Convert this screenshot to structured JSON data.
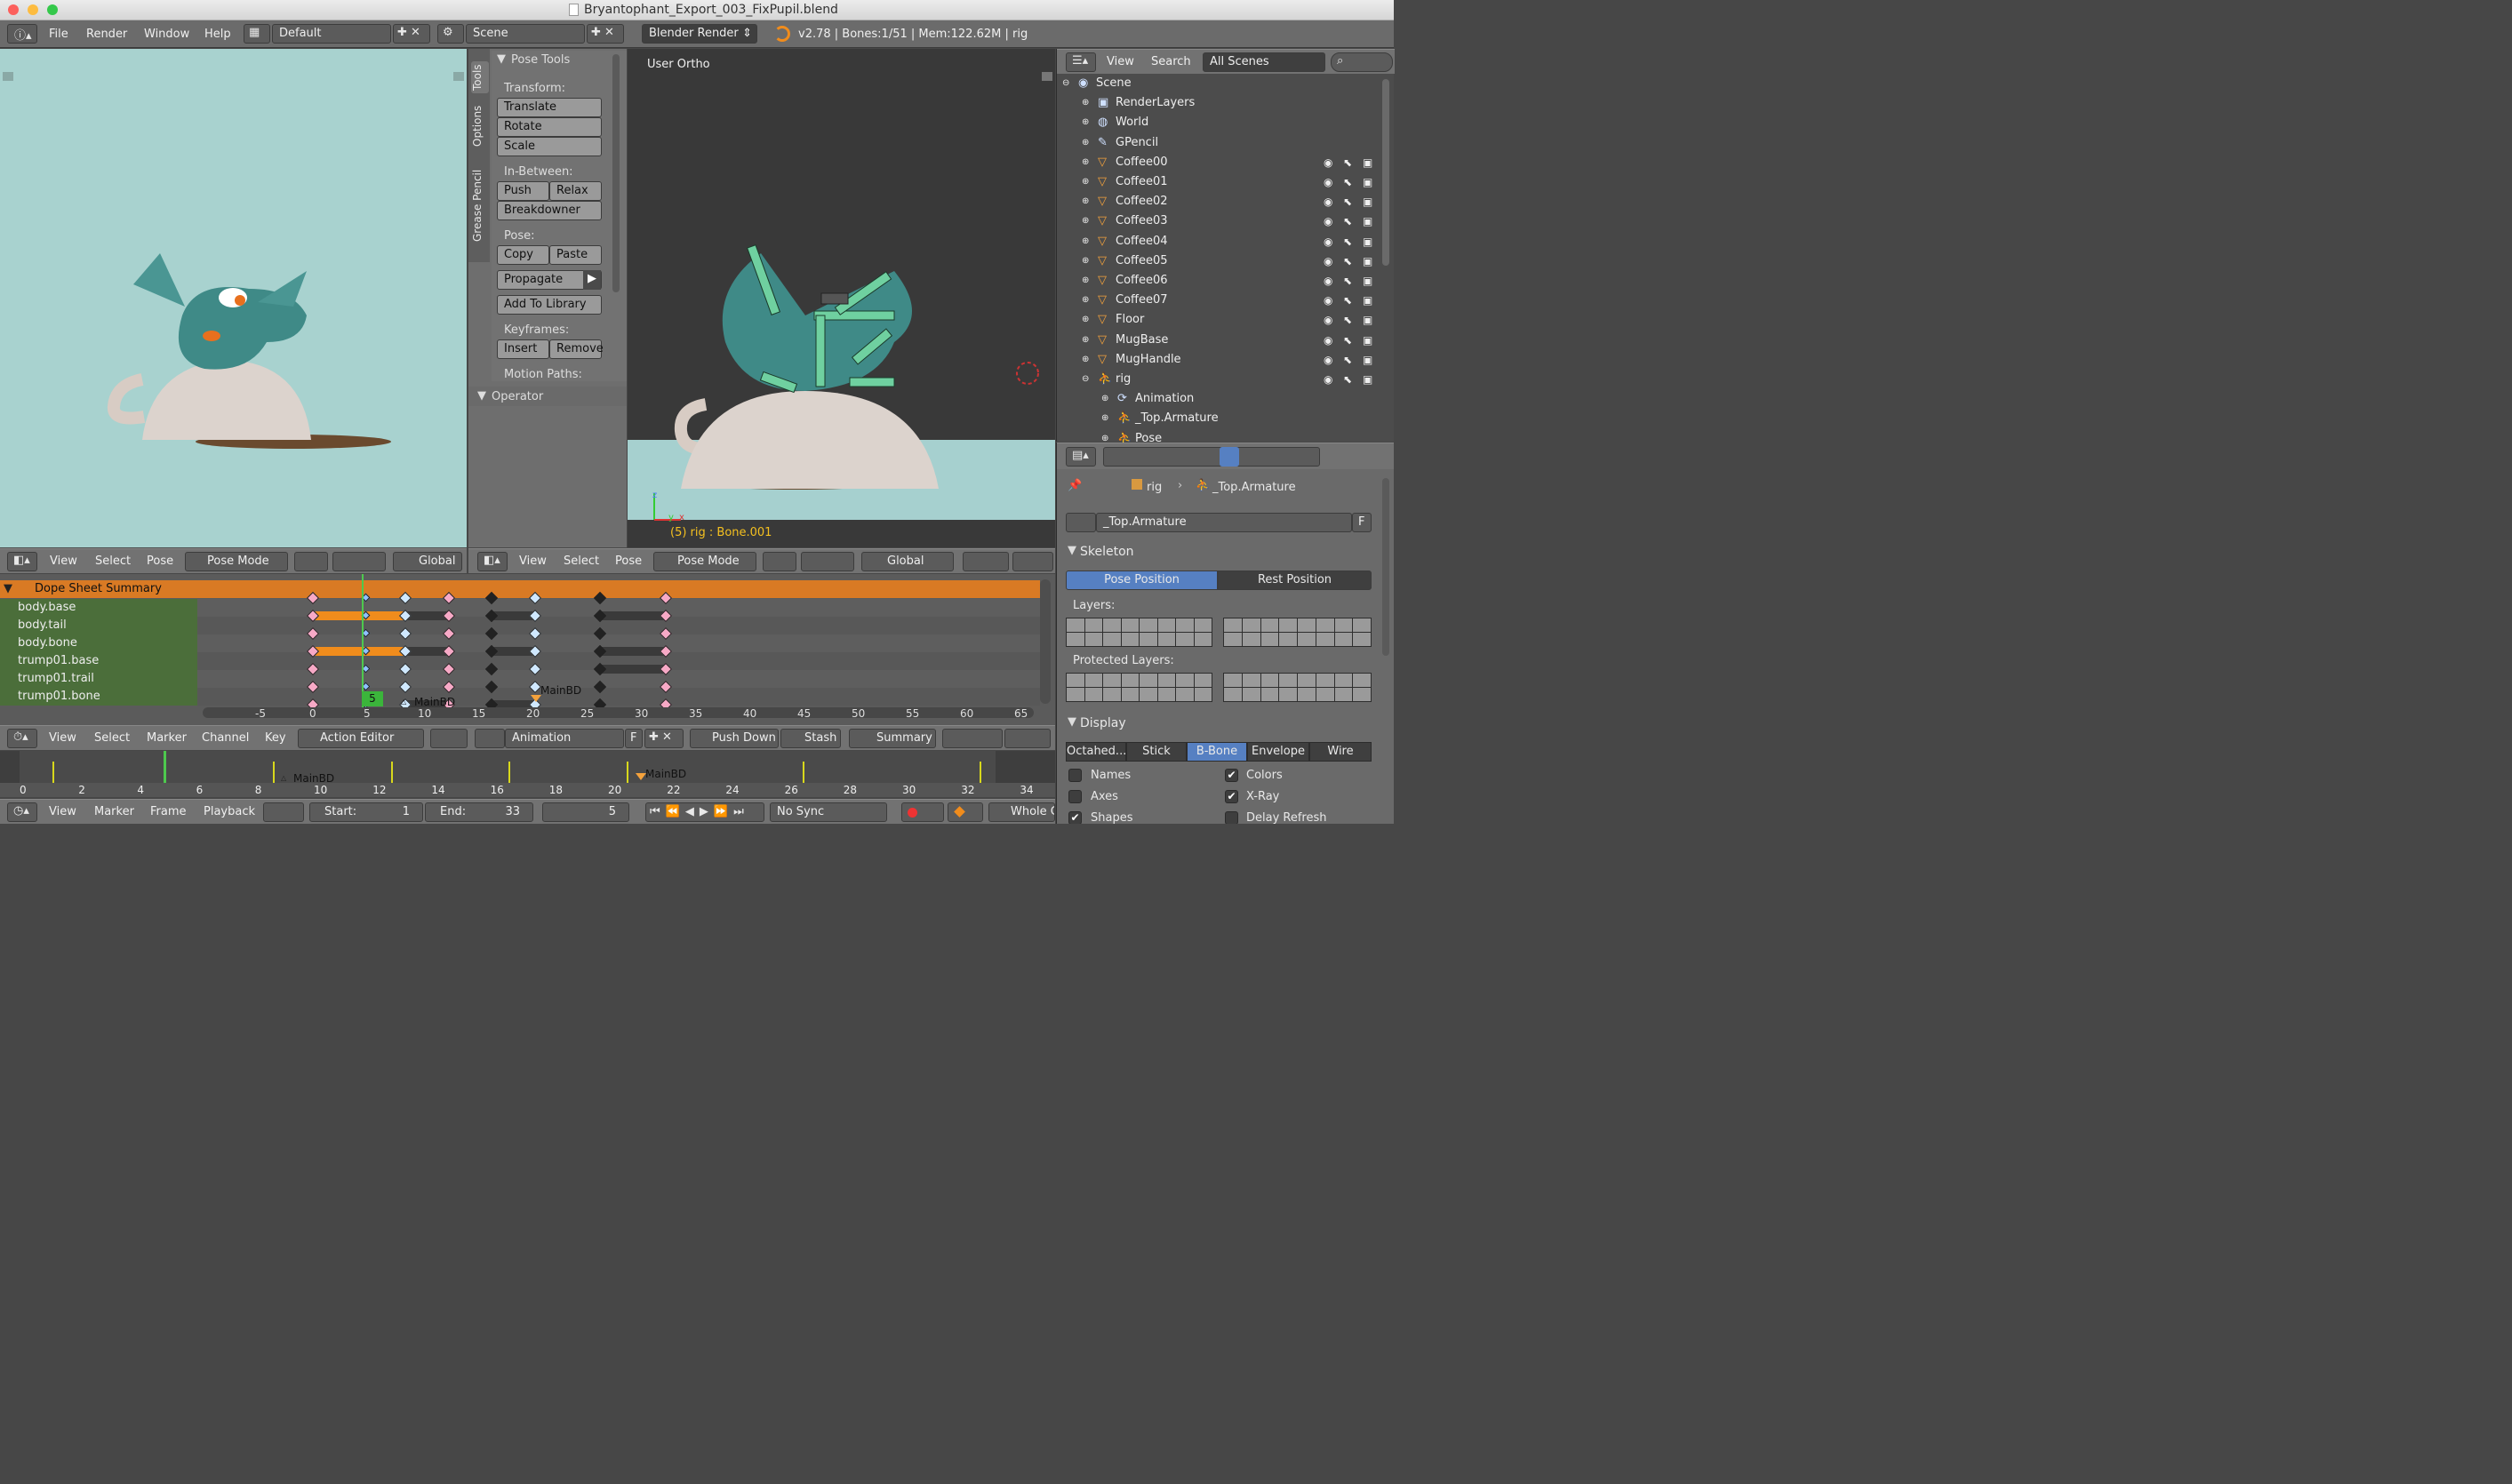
{
  "window": {
    "title": "Bryantophant_Export_003_FixPupil.blend"
  },
  "menubar": {
    "menus": [
      "File",
      "Render",
      "Window",
      "Help"
    ],
    "layout": "Default",
    "scene": "Scene",
    "engine": "Blender Render",
    "stats": "v2.78 | Bones:1/51 | Mem:122.62M | rig"
  },
  "tool_shelf": {
    "tabs": [
      "Tools",
      "Options",
      "Grease Pencil"
    ],
    "panel_title": "Pose Tools",
    "transform_label": "Transform:",
    "translate": "Translate",
    "rotate": "Rotate",
    "scale": "Scale",
    "inbetween_label": "In-Between:",
    "push": "Push",
    "relax": "Relax",
    "breakdowner": "Breakdowner",
    "pose_label": "Pose:",
    "copy": "Copy",
    "paste": "Paste",
    "propagate": "Propagate",
    "add_to_library": "Add To Library",
    "keyframes_label": "Keyframes:",
    "insert": "Insert",
    "remove": "Remove",
    "motion_paths_label": "Motion Paths:",
    "operator": "Operator"
  },
  "viewport_right": {
    "label": "User Ortho",
    "status": "(5) rig : Bone.001",
    "axis_z": "z",
    "axis_y": "y",
    "axis_x": "x"
  },
  "view3d_header": {
    "view": "View",
    "select": "Select",
    "pose": "Pose",
    "mode": "Pose Mode",
    "orientation": "Global"
  },
  "outliner": {
    "view": "View",
    "search": "Search",
    "filter": "All Scenes",
    "items": [
      {
        "label": "Scene"
      },
      {
        "label": "RenderLayers"
      },
      {
        "label": "World"
      },
      {
        "label": "GPencil"
      },
      {
        "label": "Coffee00"
      },
      {
        "label": "Coffee01"
      },
      {
        "label": "Coffee02"
      },
      {
        "label": "Coffee03"
      },
      {
        "label": "Coffee04"
      },
      {
        "label": "Coffee05"
      },
      {
        "label": "Coffee06"
      },
      {
        "label": "Coffee07"
      },
      {
        "label": "Floor"
      },
      {
        "label": "MugBase"
      },
      {
        "label": "MugHandle"
      },
      {
        "label": "rig"
      },
      {
        "label": "Animation"
      },
      {
        "label": "_Top.Armature"
      },
      {
        "label": "Pose"
      }
    ]
  },
  "properties": {
    "breadcrumb_obj": "rig",
    "breadcrumb_data": "_Top.Armature",
    "datablock": "_Top.Armature",
    "datablock_f": "F",
    "skeleton": "Skeleton",
    "pose_position": "Pose Position",
    "rest_position": "Rest Position",
    "layers": "Layers:",
    "protected_layers": "Protected Layers:",
    "display": "Display",
    "display_modes": [
      "Octahed...",
      "Stick",
      "B-Bone",
      "Envelope",
      "Wire"
    ],
    "names": "Names",
    "axes": "Axes",
    "shapes": "Shapes",
    "colors": "Colors",
    "xray": "X-Ray",
    "delay_refresh": "Delay Refresh"
  },
  "dopesheet": {
    "summary": "Dope Sheet Summary",
    "channels": [
      "body.base",
      "body.tail",
      "body.bone",
      "trump01.base",
      "trump01.trail",
      "trump01.bone"
    ],
    "ruler": [
      "-5",
      "0",
      "5",
      "10",
      "15",
      "20",
      "25",
      "30",
      "35",
      "40",
      "45",
      "50",
      "55",
      "60",
      "65"
    ],
    "current_frame": "5",
    "marker": "MainBD",
    "header": {
      "view": "View",
      "select": "Select",
      "marker": "Marker",
      "channel": "Channel",
      "key": "Key",
      "mode": "Action Editor",
      "action": "Animation",
      "action_f": "F",
      "push_down": "Push Down",
      "stash": "Stash",
      "summary": "Summary"
    }
  },
  "timeline": {
    "ruler": [
      "0",
      "2",
      "4",
      "6",
      "8",
      "10",
      "12",
      "14",
      "16",
      "18",
      "20",
      "22",
      "24",
      "26",
      "28",
      "30",
      "32",
      "34"
    ],
    "marker": "MainBD",
    "header": {
      "view": "View",
      "marker": "Marker",
      "frame": "Frame",
      "playback": "Playback",
      "start": "Start:",
      "start_val": "1",
      "end": "End:",
      "end_val": "33",
      "current": "5",
      "sync": "No Sync",
      "keying": "Whole C"
    }
  },
  "colors": {
    "accent_blue": "#5680c2",
    "orange": "#f08c1c",
    "bg_left": "#a8d2cf"
  }
}
